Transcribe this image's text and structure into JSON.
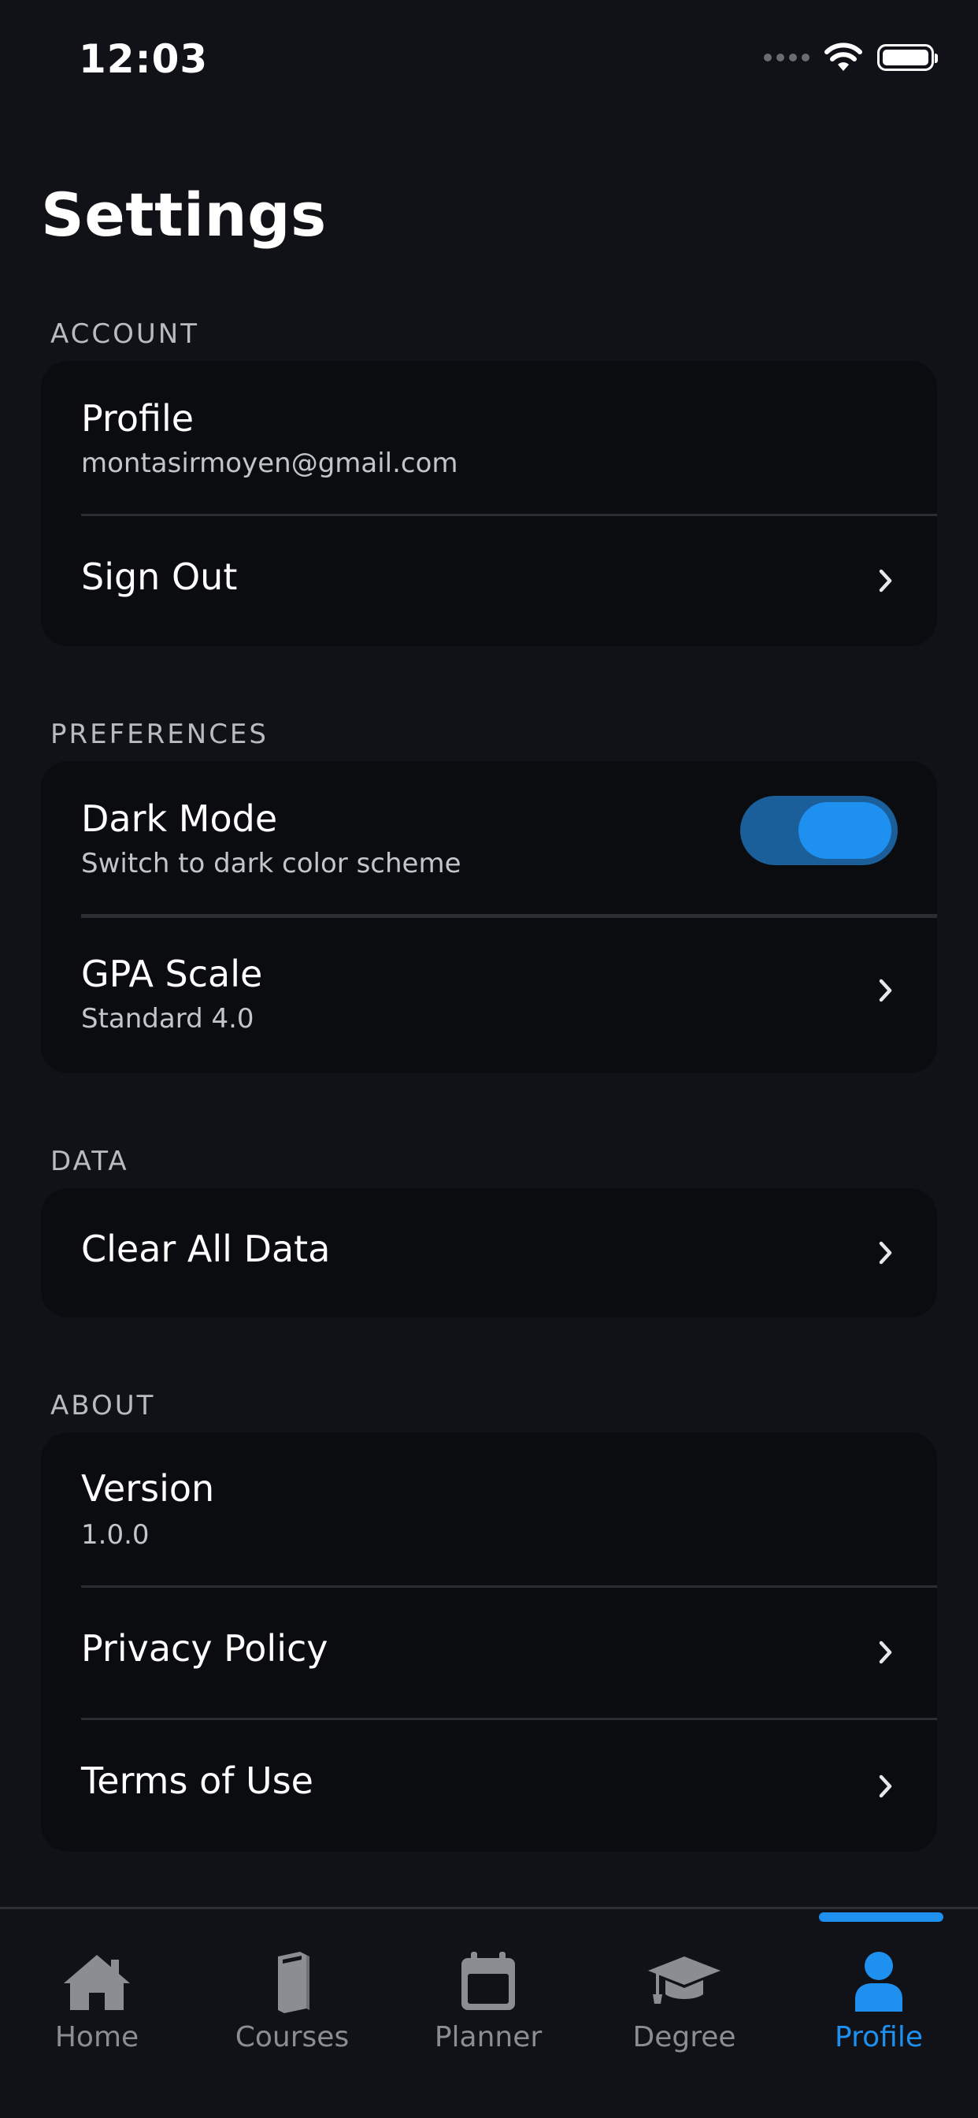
{
  "status_bar": {
    "time": "12:03"
  },
  "page": {
    "title": "Settings"
  },
  "sections": {
    "account": {
      "header": "ACCOUNT",
      "profile_title": "Profile",
      "profile_email": "montasirmoyen@gmail.com",
      "sign_out": "Sign Out"
    },
    "preferences": {
      "header": "PREFERENCES",
      "dark_mode_title": "Dark Mode",
      "dark_mode_sub": "Switch to dark color scheme",
      "dark_mode_on": true,
      "gpa_title": "GPA Scale",
      "gpa_sub": "Standard 4.0"
    },
    "data": {
      "header": "DATA",
      "clear_all": "Clear All Data"
    },
    "about": {
      "header": "ABOUT",
      "version_title": "Version",
      "version_value": "1.0.0",
      "privacy": "Privacy Policy",
      "terms": "Terms of Use"
    }
  },
  "tabs": [
    {
      "label": "Home",
      "icon": "home-icon",
      "active": false
    },
    {
      "label": "Courses",
      "icon": "book-icon",
      "active": false
    },
    {
      "label": "Planner",
      "icon": "calendar-icon",
      "active": false
    },
    {
      "label": "Degree",
      "icon": "graduation-cap-icon",
      "active": false
    },
    {
      "label": "Profile",
      "icon": "person-icon",
      "active": true
    }
  ],
  "colors": {
    "background": "#111217",
    "card": "#0b0c10",
    "accent": "#1e90f0",
    "toggle_track": "#1b5f9a",
    "inactive_tab": "#8b8d93"
  }
}
